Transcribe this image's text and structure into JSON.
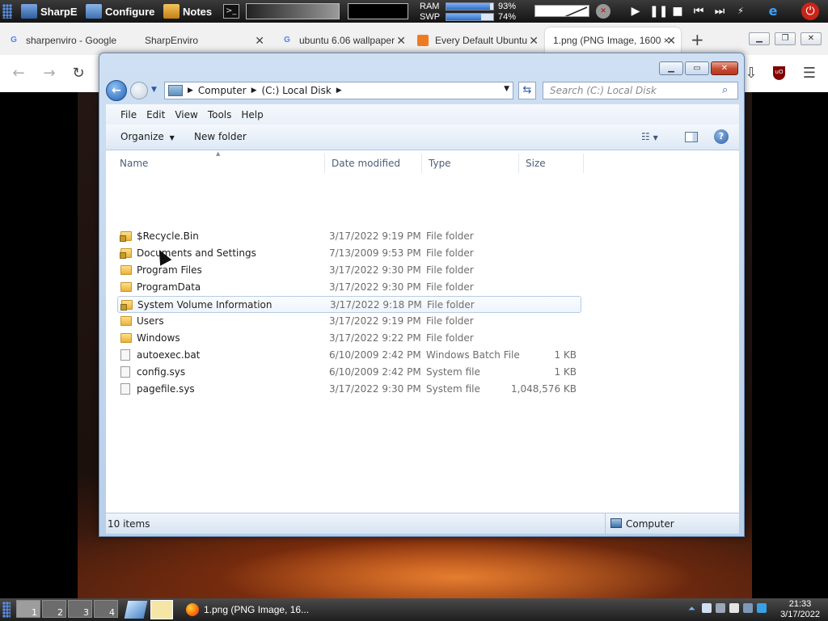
{
  "topbar": {
    "items": [
      {
        "label": "SharpE",
        "icon": "sharpe-icon"
      },
      {
        "label": "Configure",
        "icon": "configure-icon"
      },
      {
        "label": "Notes",
        "icon": "notes-icon"
      }
    ],
    "ram": {
      "label": "RAM",
      "value": "93%",
      "fraction": 0.93
    },
    "swp": {
      "label": "SWP",
      "value": "74%",
      "fraction": 0.74
    }
  },
  "browser": {
    "tabs": [
      {
        "title": "sharpenviro - Google",
        "favicon": "google-icon"
      },
      {
        "title": "SharpEnviro",
        "favicon": "none"
      },
      {
        "title": "ubuntu 6.06 wallpaper",
        "favicon": "google-icon"
      },
      {
        "title": "Every Default Ubuntu",
        "favicon": "omg-icon"
      },
      {
        "title": "1.png (PNG Image, 1600 ×",
        "favicon": "none",
        "active": true
      }
    ],
    "new_tab_label": "+"
  },
  "explorer": {
    "breadcrumb": [
      "Computer",
      "(C:) Local Disk"
    ],
    "search_placeholder": "Search (C:) Local Disk",
    "menu": [
      "File",
      "Edit",
      "View",
      "Tools",
      "Help"
    ],
    "toolbar": {
      "organize": "Organize",
      "new_folder": "New folder"
    },
    "columns": {
      "name": "Name",
      "date": "Date modified",
      "type": "Type",
      "size": "Size"
    },
    "files": [
      {
        "name": "$Recycle.Bin",
        "date": "3/17/2022 9:19 PM",
        "type": "File folder",
        "size": "",
        "icon": "locked-folder-icon"
      },
      {
        "name": "Documents and Settings",
        "date": "7/13/2009 9:53 PM",
        "type": "File folder",
        "size": "",
        "icon": "locked-folder-icon"
      },
      {
        "name": "Program Files",
        "date": "3/17/2022 9:30 PM",
        "type": "File folder",
        "size": "",
        "icon": "folder-icon"
      },
      {
        "name": "ProgramData",
        "date": "3/17/2022 9:30 PM",
        "type": "File folder",
        "size": "",
        "icon": "folder-icon"
      },
      {
        "name": "System Volume Information",
        "date": "3/17/2022 9:18 PM",
        "type": "File folder",
        "size": "",
        "icon": "locked-folder-icon",
        "selected": true
      },
      {
        "name": "Users",
        "date": "3/17/2022 9:19 PM",
        "type": "File folder",
        "size": "",
        "icon": "folder-icon"
      },
      {
        "name": "Windows",
        "date": "3/17/2022 9:22 PM",
        "type": "File folder",
        "size": "",
        "icon": "folder-icon"
      },
      {
        "name": "autoexec.bat",
        "date": "6/10/2009 2:42 PM",
        "type": "Windows Batch File",
        "size": "1 KB",
        "icon": "batch-file-icon"
      },
      {
        "name": "config.sys",
        "date": "6/10/2009 2:42 PM",
        "type": "System file",
        "size": "1 KB",
        "icon": "system-file-icon"
      },
      {
        "name": "pagefile.sys",
        "date": "3/17/2022 9:30 PM",
        "type": "System file",
        "size": "1,048,576 KB",
        "icon": "system-file-icon"
      }
    ],
    "status": {
      "count": "10 items",
      "location": "Computer"
    }
  },
  "taskbar": {
    "desktops": [
      "1",
      "2",
      "3",
      "4"
    ],
    "task_label": "1.png (PNG Image, 16...",
    "clock": {
      "time": "21:33",
      "date": "3/17/2022"
    }
  }
}
